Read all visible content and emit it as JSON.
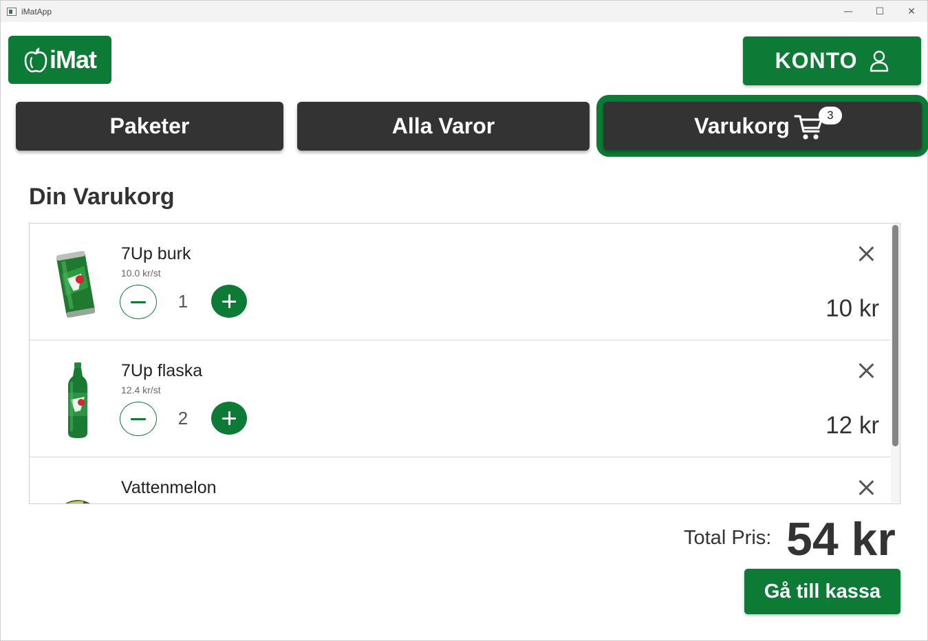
{
  "window": {
    "title": "iMatApp",
    "controls": {
      "minimize": "—",
      "maximize": "☐",
      "close": "✕"
    }
  },
  "header": {
    "logo_text": "iMat",
    "logo_icon": "apple-icon",
    "account_label": "KONTO",
    "account_icon": "user-icon"
  },
  "nav": {
    "tabs": [
      {
        "label": "Paketer",
        "active": false
      },
      {
        "label": "Alla Varor",
        "active": false
      },
      {
        "label": "Varukorg",
        "active": true,
        "icon": "cart-icon",
        "badge": "3"
      }
    ]
  },
  "main": {
    "title": "Din Varukorg",
    "items": [
      {
        "name": "7Up burk",
        "unit_price": "10.0 kr/st",
        "quantity": "1",
        "price": "10 kr",
        "image": "soda-can"
      },
      {
        "name": "7Up flaska",
        "unit_price": "12.4 kr/st",
        "quantity": "2",
        "price": "12 kr",
        "image": "soda-bottle"
      },
      {
        "name": "Vattenmelon",
        "unit_price": "",
        "quantity": "",
        "price": "",
        "image": "watermelon"
      }
    ]
  },
  "footer": {
    "total_label": "Total Pris:",
    "total_value": "54 kr",
    "checkout_label": "Gå till kassa"
  },
  "colors": {
    "brand_green": "#0d7a36",
    "nav_dark": "#333333"
  }
}
